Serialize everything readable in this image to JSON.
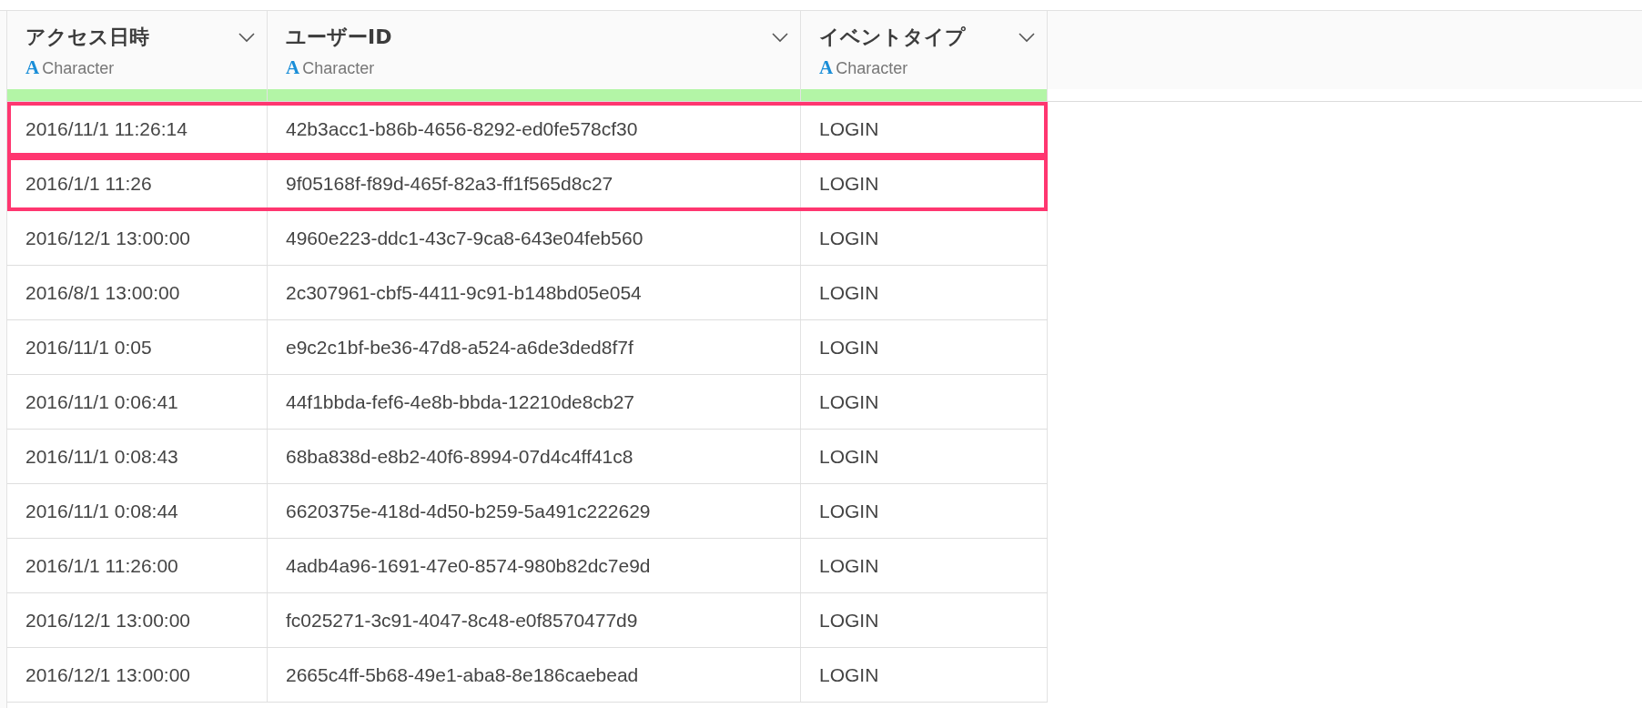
{
  "columns": [
    {
      "title": "アクセス日時",
      "type_glyph": "A",
      "type": "Character"
    },
    {
      "title": "ユーザーID",
      "type_glyph": "A",
      "type": "Character"
    },
    {
      "title": "イベントタイプ",
      "type_glyph": "A",
      "type": "Character"
    }
  ],
  "rows": [
    {
      "cells": [
        "2016/11/1 11:26:14",
        "42b3acc1-b86b-4656-8292-ed0fe578cf30",
        "LOGIN"
      ],
      "highlighted": true
    },
    {
      "cells": [
        "2016/1/1 11:26",
        "9f05168f-f89d-465f-82a3-ff1f565d8c27",
        "LOGIN"
      ],
      "highlighted": true
    },
    {
      "cells": [
        "2016/12/1 13:00:00",
        "4960e223-ddc1-43c7-9ca8-643e04feb560",
        "LOGIN"
      ],
      "highlighted": false
    },
    {
      "cells": [
        "2016/8/1 13:00:00",
        "2c307961-cbf5-4411-9c91-b148bd05e054",
        "LOGIN"
      ],
      "highlighted": false
    },
    {
      "cells": [
        "2016/11/1 0:05",
        "e9c2c1bf-be36-47d8-a524-a6de3ded8f7f",
        "LOGIN"
      ],
      "highlighted": false
    },
    {
      "cells": [
        "2016/11/1 0:06:41",
        "44f1bbda-fef6-4e8b-bbda-12210de8cb27",
        "LOGIN"
      ],
      "highlighted": false
    },
    {
      "cells": [
        "2016/11/1 0:08:43",
        "68ba838d-e8b2-40f6-8994-07d4c4ff41c8",
        "LOGIN"
      ],
      "highlighted": false
    },
    {
      "cells": [
        "2016/11/1 0:08:44",
        "6620375e-418d-4d50-b259-5a491c222629",
        "LOGIN"
      ],
      "highlighted": false
    },
    {
      "cells": [
        "2016/1/1 11:26:00",
        "4adb4a96-1691-47e0-8574-980b82dc7e9d",
        "LOGIN"
      ],
      "highlighted": false
    },
    {
      "cells": [
        "2016/12/1 13:00:00",
        "fc025271-3c91-4047-8c48-e0f8570477d9",
        "LOGIN"
      ],
      "highlighted": false
    },
    {
      "cells": [
        "2016/12/1 13:00:00",
        "2665c4ff-5b68-49e1-aba8-8e186caebead",
        "LOGIN"
      ],
      "highlighted": false
    }
  ]
}
